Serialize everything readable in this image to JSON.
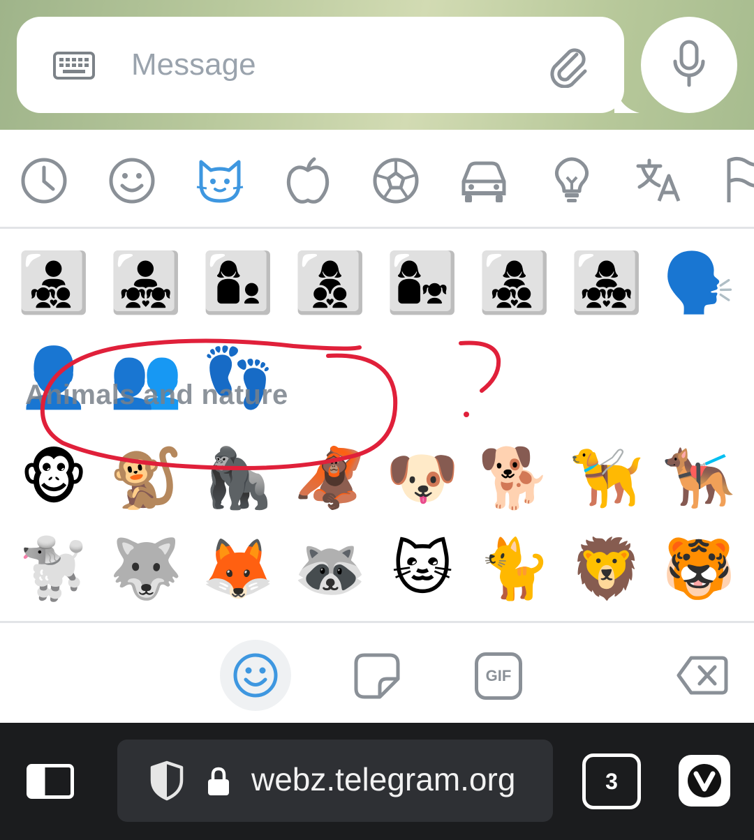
{
  "composer": {
    "placeholder": "Message",
    "icons": {
      "keyboard": "keyboard-icon",
      "attach": "paperclip-icon",
      "mic": "microphone-icon"
    }
  },
  "categories": [
    {
      "name": "recent",
      "icon": "clock-icon"
    },
    {
      "name": "people",
      "icon": "smiley-icon"
    },
    {
      "name": "animals",
      "icon": "cat-icon",
      "active": true
    },
    {
      "name": "food",
      "icon": "apple-icon"
    },
    {
      "name": "activity",
      "icon": "soccer-ball-icon"
    },
    {
      "name": "travel",
      "icon": "car-icon"
    },
    {
      "name": "objects",
      "icon": "lightbulb-icon"
    },
    {
      "name": "symbols",
      "icon": "translate-icon"
    },
    {
      "name": "flags",
      "icon": "flag-icon"
    }
  ],
  "emoji_rows": {
    "row1": [
      "👨‍👧‍👦",
      "👨‍👧‍👧",
      "👩‍👦",
      "👩‍👦‍👦",
      "👩‍👧",
      "👩‍👧‍👦",
      "👩‍👧‍👧",
      "🗣️"
    ],
    "row2": [
      "👤",
      "👥",
      "👣"
    ],
    "row3": [
      "🐵",
      "🐒",
      "🦍",
      "🦧",
      "🐶",
      "🐕",
      "🦮",
      "🐕‍🦺"
    ],
    "row4": [
      "🐩",
      "🐺",
      "🦊",
      "🦝",
      "🐱",
      "🐈",
      "🦁",
      "🐯"
    ]
  },
  "section_label": "Animals and nature",
  "toolbar": {
    "gif_label": "GIF"
  },
  "browser": {
    "url": "webz.telegram.org",
    "tab_count": "3"
  },
  "colors": {
    "accent": "#3e97e0",
    "icon_gray": "#8a9097",
    "annotation_red": "#e0203a",
    "browser_bg": "#1b1c1e"
  }
}
